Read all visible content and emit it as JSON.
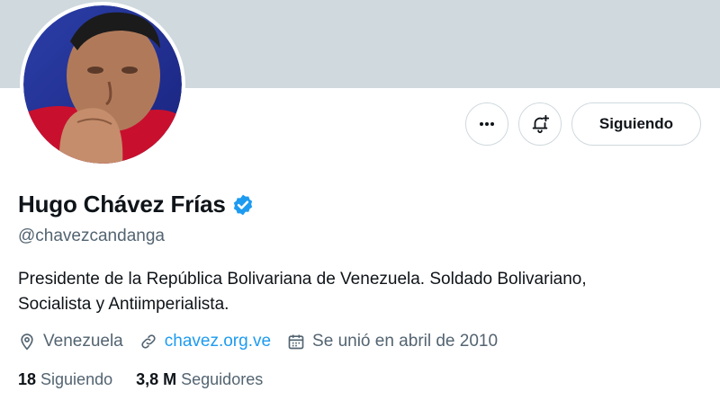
{
  "profile": {
    "display_name": "Hugo Chávez Frías",
    "handle": "@chavezcandanga",
    "bio_line1": "Presidente de la República Bolivariana de Venezuela. Soldado Bolivariano,",
    "bio_line2": "Socialista y Antiimperialista.",
    "location": "Venezuela",
    "website": "chavez.org.ve",
    "joined": "Se unió en abril de 2010",
    "verified_icon": "verified-badge-icon"
  },
  "actions": {
    "more_icon": "more-icon",
    "notify_icon": "bell-plus-icon",
    "follow_label": "Siguiendo"
  },
  "stats": {
    "following_count": "18",
    "following_label": "Siguiendo",
    "followers_count": "3,8 M",
    "followers_label": "Seguidores"
  },
  "colors": {
    "banner": "#cfd9de",
    "accent": "#1d9bf0",
    "secondary_text": "#536471"
  }
}
